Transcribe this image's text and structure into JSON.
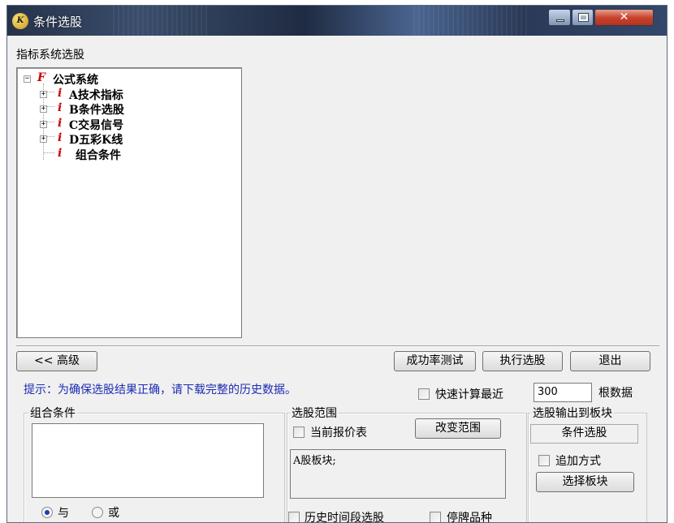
{
  "window": {
    "title": "条件选股"
  },
  "app_icon_text": "K",
  "section_label": "指标系统选股",
  "tree": {
    "root": {
      "toggle": "−",
      "icon": "F",
      "label": "公式系统"
    },
    "items": [
      {
        "toggle": "+",
        "icon": "i",
        "label": "A技术指标"
      },
      {
        "toggle": "+",
        "icon": "i",
        "label": "B条件选股"
      },
      {
        "toggle": "+",
        "icon": "i",
        "label": "C交易信号"
      },
      {
        "toggle": "+",
        "icon": "i",
        "label": "D五彩K线"
      },
      {
        "toggle": "",
        "icon": "i",
        "label": "组合条件"
      }
    ]
  },
  "buttons": {
    "advanced": "<< 高级",
    "success_test": "成功率测试",
    "execute": "执行选股",
    "exit": "退出",
    "change_range": "改变范围",
    "select_block": "选择板块"
  },
  "hint": "提示：为确保选股结果正确，请下载完整的历史数据。",
  "fast_calc": {
    "label": "快速计算最近",
    "value": "300",
    "suffix": "根数据"
  },
  "combo_group": {
    "title": "组合条件",
    "and_label": "与",
    "or_label": "或"
  },
  "range_group": {
    "title": "选股范围",
    "current_quote_label": "当前报价表",
    "range_text": "A股板块;",
    "history_label": "历史时间段选股",
    "suspended_label": "停牌品种"
  },
  "output_group": {
    "title": "选股输出到板块",
    "block_name": "条件选股",
    "append_label": "追加方式"
  },
  "colors": {
    "hint": "#1c2bb4",
    "tree_icon": "#cc0000",
    "close_button": "#c8452f"
  }
}
